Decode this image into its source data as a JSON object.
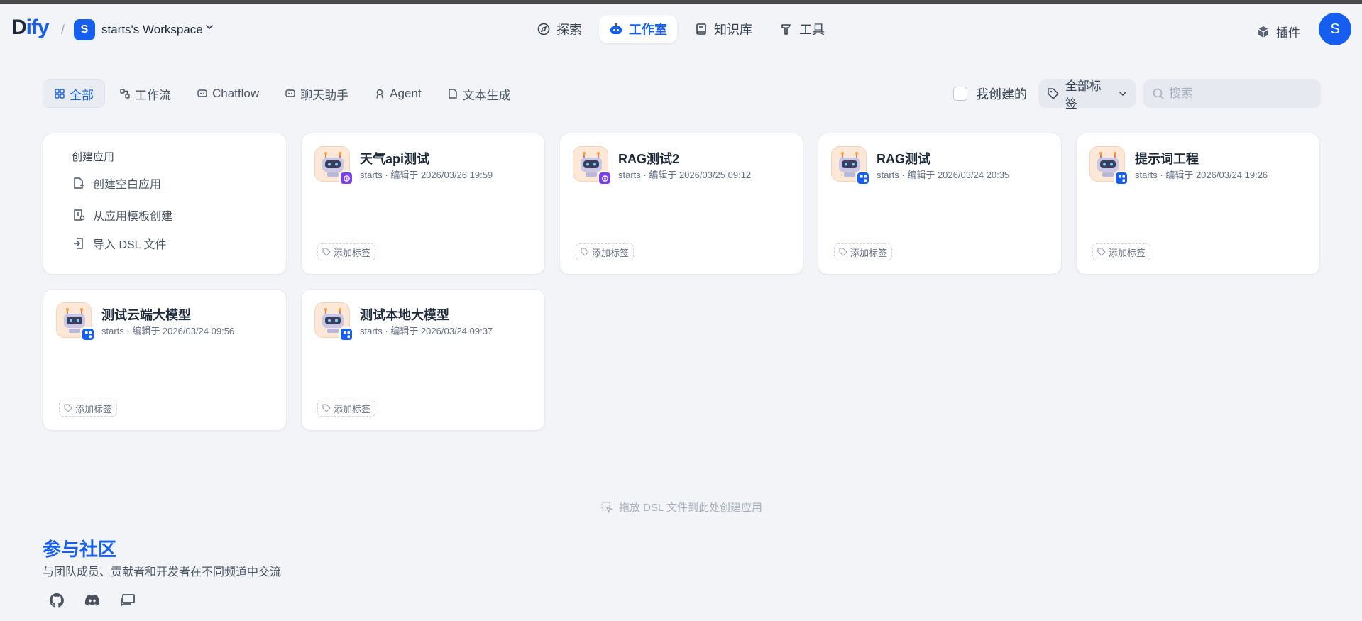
{
  "header": {
    "logo_prefix": "D",
    "logo_suffix": "ify",
    "workspace_initial": "S",
    "workspace_name": "starts's Workspace",
    "nav": [
      {
        "label": "探索",
        "icon": "compass-icon"
      },
      {
        "label": "工作室",
        "icon": "robot-icon",
        "active": true
      },
      {
        "label": "知识库",
        "icon": "book-icon"
      },
      {
        "label": "工具",
        "icon": "hammer-icon"
      }
    ],
    "plugin_label": "插件",
    "user_initial": "S"
  },
  "filters": {
    "tabs": [
      {
        "label": "全部",
        "active": true
      },
      {
        "label": "工作流"
      },
      {
        "label": "Chatflow"
      },
      {
        "label": "聊天助手"
      },
      {
        "label": "Agent"
      },
      {
        "label": "文本生成"
      }
    ],
    "mine_label": "我创建的",
    "tag_filter_label": "全部标签",
    "search_placeholder": "搜索"
  },
  "create": {
    "title": "创建应用",
    "items": [
      "创建空白应用",
      "从应用模板创建",
      "导入 DSL 文件"
    ]
  },
  "apps": [
    {
      "name": "天气api测试",
      "meta": "starts · 编辑于 2026/03/26 19:59",
      "badge": "purple",
      "tag": "添加标签"
    },
    {
      "name": "RAG测试2",
      "meta": "starts · 编辑于 2026/03/25 09:12",
      "badge": "purple",
      "tag": "添加标签"
    },
    {
      "name": "RAG测试",
      "meta": "starts · 编辑于 2026/03/24 20:35",
      "badge": "blue",
      "tag": "添加标签"
    },
    {
      "name": "提示词工程",
      "meta": "starts · 编辑于 2026/03/24 19:26",
      "badge": "blue",
      "tag": "添加标签"
    },
    {
      "name": "测试云端大模型",
      "meta": "starts · 编辑于 2026/03/24 09:56",
      "badge": "blue",
      "tag": "添加标签"
    },
    {
      "name": "测试本地大模型",
      "meta": "starts · 编辑于 2026/03/24 09:37",
      "badge": "blue",
      "tag": "添加标签"
    }
  ],
  "drop_hint": "拖放 DSL 文件到此处创建应用",
  "community": {
    "title": "参与社区",
    "subtitle": "与团队成员、贡献者和开发者在不同频道中交流",
    "links": [
      "github-icon",
      "discord-icon",
      "forum-icon"
    ]
  },
  "colors": {
    "accent": "#155eef",
    "background": "#f2f4f7",
    "purple_badge": "#7a3ff0"
  }
}
